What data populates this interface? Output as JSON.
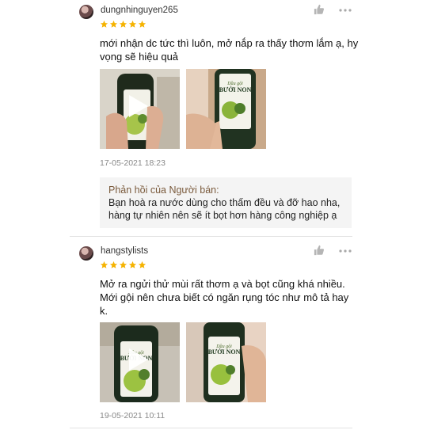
{
  "reviews": [
    {
      "username": "dungnhinguyen265",
      "rating": 5,
      "comment": "mới nhận dc tức thì luôn, mở nắp ra thấy thơm lắm ạ, hy\nvọng sẽ hiệu quả",
      "timestamp": "17-05-2021 18:23",
      "reply_title": "Phản hồi của Người bán:",
      "reply_body": "Bạn hoà ra nước dùng cho thấm đều và đỡ hao nha,\nhàng tự nhiên nên sẽ ít bọt hơn hàng công nghiệp ạ",
      "bottle_label": "BƯỞI NON"
    },
    {
      "username": "hangstylists",
      "rating": 5,
      "comment": "Mở ra ngửi thử mùi rất thơm ạ và bọt cũng khá nhiều.\nMới gội nên chưa biết có ngăn rụng tóc như mô tả hay\nk.",
      "timestamp": "19-05-2021 10:11",
      "bottle_label": "BƯỞI NON"
    }
  ],
  "icons": {
    "like": "thumbs-up-icon",
    "more": "more-options-icon",
    "star": "star-icon",
    "play": "play-icon"
  },
  "colors": {
    "star": "#f5b301",
    "reply_title": "#7a5a3c",
    "reply_bg": "#f4f4f4"
  }
}
